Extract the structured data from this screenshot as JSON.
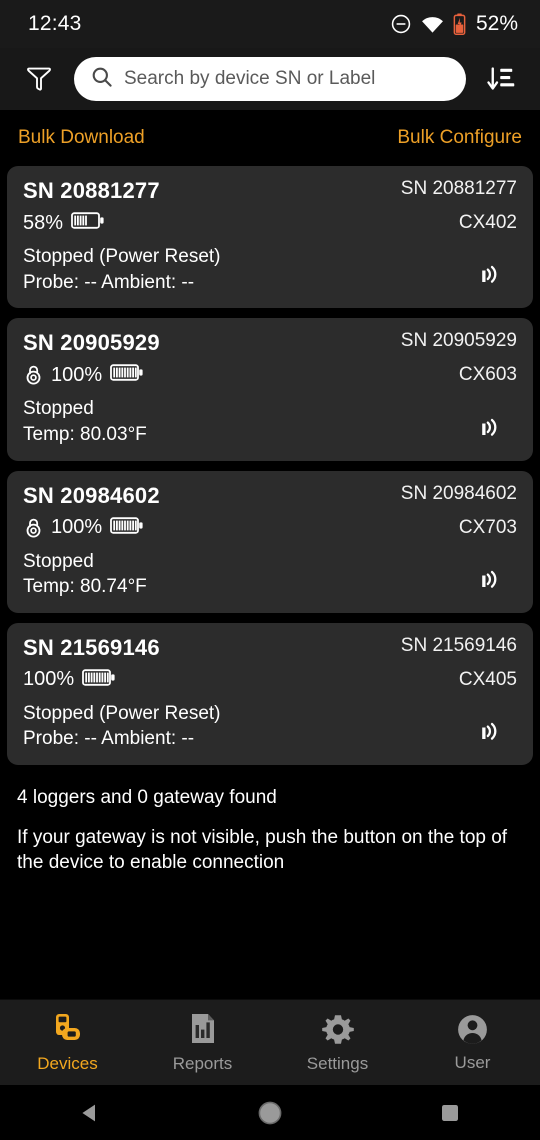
{
  "status_bar": {
    "time": "12:43",
    "dnd_icon": "do-not-disturb-icon",
    "wifi_icon": "wifi-icon",
    "battery_icon": "battery-icon",
    "battery_percent": "52%",
    "battery_color": "#e8613c"
  },
  "header": {
    "filter_icon": "filter-funnel-icon",
    "search_placeholder": "Search by device SN or Label",
    "search_value": "",
    "search_icon": "search-icon",
    "sort_icon": "sort-descending-icon"
  },
  "bulk_actions": {
    "download_label": "Bulk Download",
    "configure_label": "Bulk Configure",
    "accent_color": "#eda027"
  },
  "devices": [
    {
      "sn_main": "SN 20881277",
      "sn_right": "SN 20881277",
      "battery": "58%",
      "battery_level": 58,
      "has_lock": false,
      "model": "CX402",
      "status": "Stopped (Power Reset)",
      "readings": "Probe: -- Ambient: --",
      "signal_icon": "antenna-signal-icon"
    },
    {
      "sn_main": "SN 20905929",
      "sn_right": "SN 20905929",
      "battery": "100%",
      "battery_level": 100,
      "has_lock": true,
      "model": "CX603",
      "status": "Stopped",
      "readings": "Temp: 80.03°F",
      "signal_icon": "antenna-signal-icon"
    },
    {
      "sn_main": "SN 20984602",
      "sn_right": "SN 20984602",
      "battery": "100%",
      "battery_level": 100,
      "has_lock": true,
      "model": "CX703",
      "status": "Stopped",
      "readings": "Temp: 80.74°F",
      "signal_icon": "antenna-signal-icon"
    },
    {
      "sn_main": "SN 21569146",
      "sn_right": "SN 21569146",
      "battery": "100%",
      "battery_level": 100,
      "has_lock": false,
      "model": "CX405",
      "status": "Stopped (Power Reset)",
      "readings": "Probe: -- Ambient: --",
      "signal_icon": "antenna-signal-icon"
    }
  ],
  "footer": {
    "found_text": "4 loggers and 0 gateway found",
    "hint_text": "If your gateway is not visible, push the button on the top of the device to enable connection"
  },
  "bottom_nav": {
    "active_color": "#f2a71f",
    "inactive_color": "#9a9a9a",
    "items": [
      {
        "label": "Devices",
        "icon": "device-logger-icon",
        "active": true
      },
      {
        "label": "Reports",
        "icon": "report-chart-icon",
        "active": false
      },
      {
        "label": "Settings",
        "icon": "gear-icon",
        "active": false
      },
      {
        "label": "User",
        "icon": "user-avatar-icon",
        "active": false
      }
    ]
  },
  "system_nav": {
    "back_icon": "back-triangle-icon",
    "home_icon": "home-circle-icon",
    "recents_icon": "recents-square-icon"
  }
}
